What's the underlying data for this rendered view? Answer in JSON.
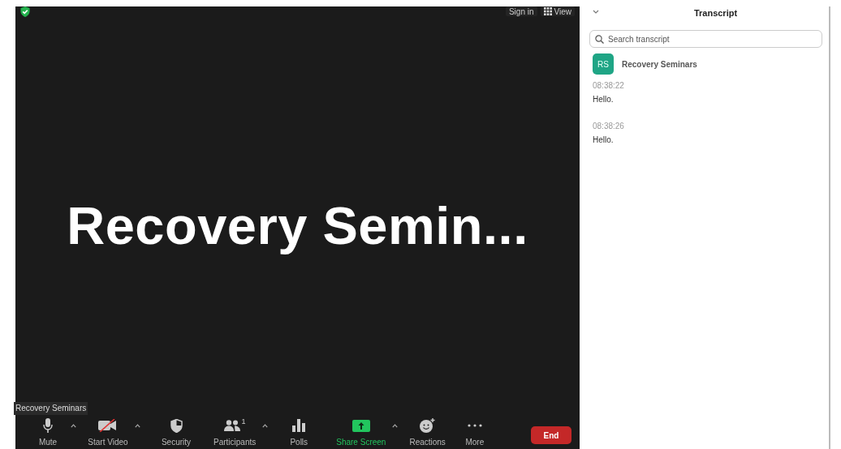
{
  "meeting": {
    "top_bar": {
      "sign_in": "Sign in",
      "view": "View"
    },
    "title": "Recovery Semin...",
    "name_tag": "Recovery Seminars",
    "toolbar": [
      {
        "kind": "mic",
        "label": "Mute",
        "caret": true
      },
      {
        "kind": "video",
        "label": "Start Video",
        "caret": true
      },
      {
        "kind": "security",
        "label": "Security",
        "caret": false
      },
      {
        "kind": "participants",
        "label": "Participants",
        "count": "1",
        "caret": true
      },
      {
        "kind": "polls",
        "label": "Polls",
        "caret": false
      },
      {
        "kind": "share",
        "label": "Share Screen",
        "caret": true
      },
      {
        "kind": "reactions",
        "label": "Reactions",
        "caret": false
      },
      {
        "kind": "more",
        "label": "More",
        "caret": false
      }
    ],
    "end_button": "End"
  },
  "transcript": {
    "title": "Transcript",
    "search": {
      "placeholder": "Search transcript"
    },
    "speaker": {
      "initials": "RS",
      "name": "Recovery Seminars"
    },
    "entries": [
      {
        "time": "08:38:22",
        "text": "Hello."
      },
      {
        "time": "08:38:26",
        "text": "Hello."
      }
    ]
  }
}
